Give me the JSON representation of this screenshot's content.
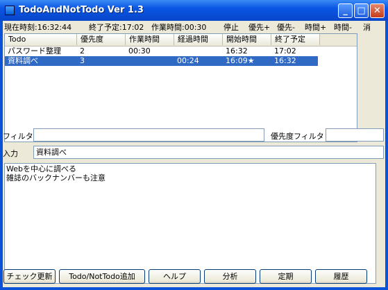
{
  "window": {
    "title": "TodoAndNotTodo Ver 1.3"
  },
  "status": {
    "current_time": "現在時刻:16:32:44",
    "end_estimate": "終了予定:17:02",
    "work_time": "作業時間:00:30",
    "stop": "停止",
    "priority_up": "優先+",
    "priority_down": "優先-",
    "time_up": "時間+",
    "time_down": "時間-",
    "erase": "消"
  },
  "list": {
    "columns": [
      "Todo",
      "優先度",
      "作業時間",
      "経過時間",
      "開始時間",
      "終了予定"
    ],
    "rows": [
      {
        "todo": "パスワード整理",
        "priority": "2",
        "work": "00:30",
        "elapsed": "",
        "start": "16:32",
        "end": "17:02",
        "selected": false
      },
      {
        "todo": "資料調べ",
        "priority": "3",
        "work": "",
        "elapsed": "00:24",
        "start": "16:09★",
        "end": "16:32",
        "selected": true
      }
    ]
  },
  "filter": {
    "label": "フィルタ",
    "value": "",
    "priority_label": "優先度フィルタ",
    "priority_value": ""
  },
  "input": {
    "label": "入力",
    "value": "資料調べ"
  },
  "memo": {
    "lines": [
      "Webを中心に調べる",
      "雑誌のバックナンバーも注意"
    ]
  },
  "buttons": {
    "check_update": "チェック更新",
    "add": "Todo/NotTodo追加",
    "help": "ヘルプ",
    "analyze": "分析",
    "periodic": "定期",
    "history": "履歴"
  },
  "colors": {
    "titlebar": "#0a55e3",
    "selection": "#316ac5",
    "face": "#ece9d8"
  }
}
